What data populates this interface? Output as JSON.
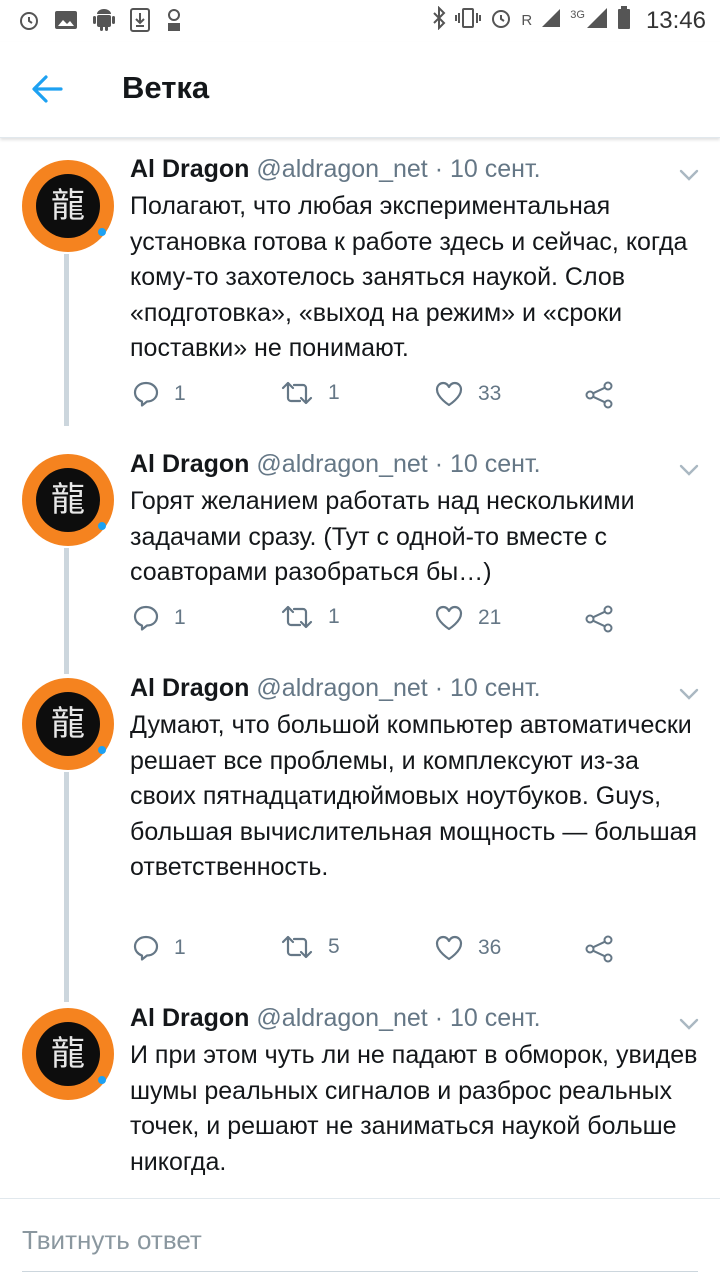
{
  "status_bar": {
    "time": "13:46",
    "network_label": "R",
    "network_type": "3G",
    "left_icons": [
      "alarm-icon",
      "gallery-icon",
      "android-icon",
      "download-icon",
      "vpn-icon"
    ],
    "right_icons": [
      "bluetooth-icon",
      "vibrate-icon",
      "alarm-icon",
      "signal-icon",
      "signal-icon",
      "battery-icon"
    ]
  },
  "app_bar": {
    "title": "Ветка",
    "back_icon": "arrow-left-icon",
    "accent_color": "#1da1f2"
  },
  "tweets": [
    {
      "name": "Al Dragon",
      "handle": "@aldragon_net",
      "separator": "·",
      "date": "10 сент.",
      "text": "Полагают, что любая экспериментальная установка готова к работе здесь и сейчас, когда кому-то захотелось заняться наукой. Слов «подготовка», «выход на режим» и «сроки поставки» не понимают.",
      "replies": "1",
      "retweets": "1",
      "likes": "33"
    },
    {
      "name": "Al Dragon",
      "handle": "@aldragon_net",
      "separator": "·",
      "date": "10 сент.",
      "text": "Горят желанием работать над несколькими задачами сразу. (Тут с одной-то вместе с соавторами разобраться бы…)",
      "replies": "1",
      "retweets": "1",
      "likes": "21"
    },
    {
      "name": "Al Dragon",
      "handle": "@aldragon_net",
      "separator": "·",
      "date": "10 сент.",
      "text": "Думают, что большой компьютер автоматически решает все проблемы, и комплексуют из-за своих пятнадцатидюймовых ноутбуков. Guys, большая вычислительная мощность — большая ответственность.",
      "replies": "1",
      "retweets": "5",
      "likes": "36"
    },
    {
      "name": "Al Dragon",
      "handle": "@aldragon_net",
      "separator": "·",
      "date": "10 сент.",
      "text": "И при этом чуть ли не падают в обморок, увидев шумы реальных сигналов и разброс реальных точек, и решают не заниматься наукой больше никогда."
    }
  ],
  "avatar_glyph": "龍",
  "reply_box": {
    "placeholder": "Твитнуть ответ"
  },
  "colors": {
    "avatar_ring": "#f5831f",
    "text_primary": "#14171a",
    "text_secondary": "#657786",
    "thread_line": "#ccd6dd"
  }
}
